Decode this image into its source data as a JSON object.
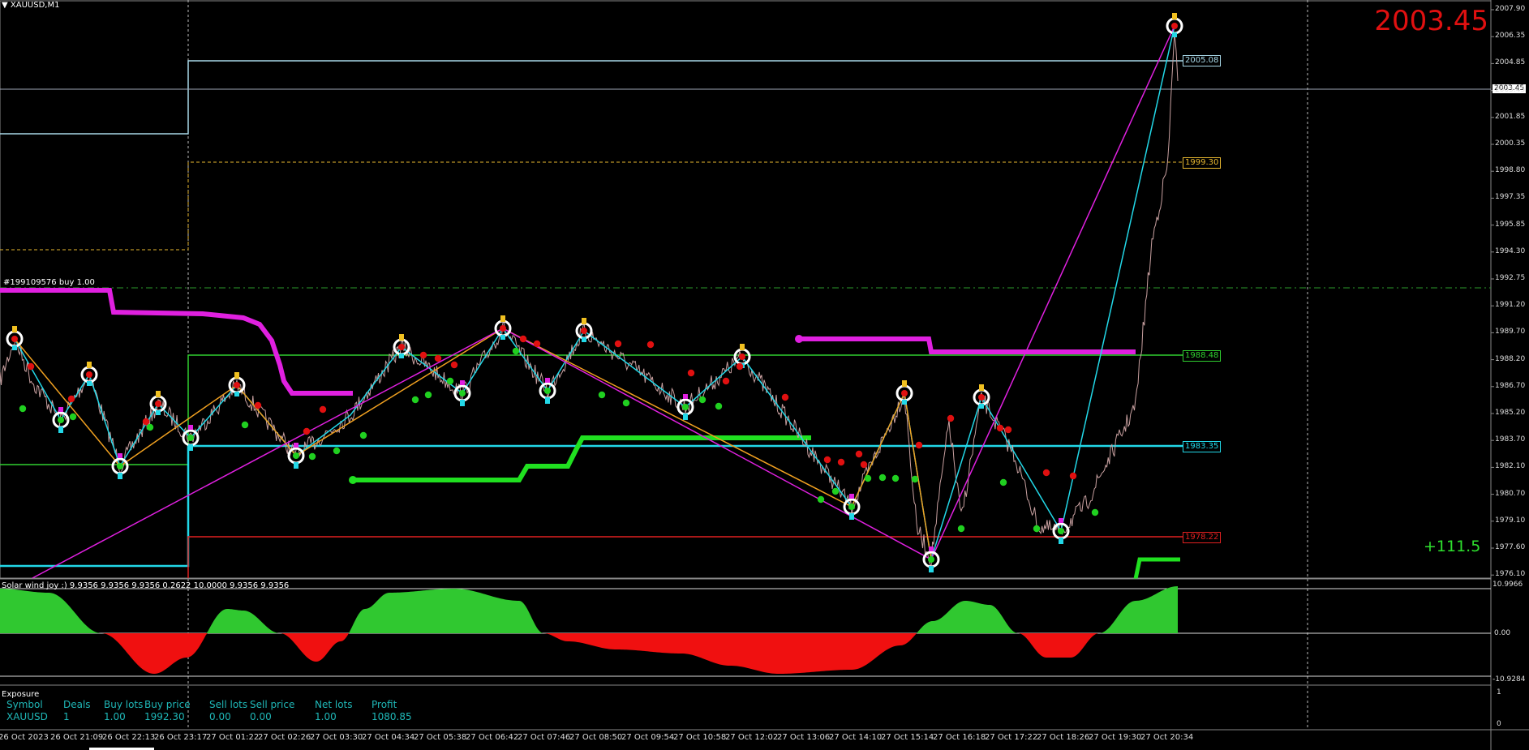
{
  "header": {
    "symbol_timeframe": "XAUUSD,M1"
  },
  "current_price_display": "2003.45",
  "current_price_tag": "2003.45",
  "order_label": "#199109576 buy 1.00",
  "profit_display": "+111.5",
  "price_axis": {
    "ticks": [
      "2007.90",
      "2006.35",
      "2004.85",
      "2003.45",
      "2001.85",
      "2000.35",
      "1998.80",
      "1997.35",
      "1995.85",
      "1994.30",
      "1992.75",
      "1991.20",
      "1989.70",
      "1988.20",
      "1986.70",
      "1985.20",
      "1983.70",
      "1982.10",
      "1980.70",
      "1979.10",
      "1977.60",
      "1976.10"
    ]
  },
  "level_boxes": [
    {
      "value": "2005.08",
      "color": "#a8d8e8"
    },
    {
      "value": "1999.30",
      "color": "#e8b830"
    },
    {
      "value": "1988.48",
      "color": "#30d030"
    },
    {
      "value": "1983.35",
      "color": "#22d8e8"
    },
    {
      "value": "1978.22",
      "color": "#e02020"
    }
  ],
  "indicator": {
    "label": "Solar wind joy :) 9.9356 9.9356 9.9356 0.2622 10.0000 9.9356 9.9356",
    "axis_top": "10.9966",
    "axis_mid": "0.00",
    "axis_bottom": "-10.9284"
  },
  "exposure": {
    "title": "Exposure",
    "headers": [
      "Symbol",
      "Deals",
      "Buy lots",
      "Buy price",
      "Sell lots",
      "Sell price",
      "Net lots",
      "Profit"
    ],
    "row": [
      "XAUUSD",
      "1",
      "1.00",
      "1992.30",
      "0.00",
      "0.00",
      "1.00",
      "1080.85"
    ],
    "axis_top": "1",
    "axis_bottom": "0"
  },
  "time_axis": [
    "26 Oct 2023",
    "26 Oct 21:09",
    "26 Oct 22:13",
    "26 Oct 23:17",
    "27 Oct 01:22",
    "27 Oct 02:26",
    "27 Oct 03:30",
    "27 Oct 04:34",
    "27 Oct 05:38",
    "27 Oct 06:42",
    "27 Oct 07:46",
    "27 Oct 08:50",
    "27 Oct 09:54",
    "27 Oct 10:58",
    "27 Oct 12:02",
    "27 Oct 13:06",
    "27 Oct 14:10",
    "27 Oct 15:14",
    "27 Oct 16:18",
    "27 Oct 17:22",
    "27 Oct 18:26",
    "27 Oct 19:30",
    "27 Oct 20:34"
  ],
  "colors": {
    "price_line": "#c8a0a0",
    "zigzag_cyan": "#22d8e8",
    "zigzag_orange": "#f0a020",
    "zigzag_magenta": "#e020e0",
    "osc_positive": "#30c830",
    "osc_negative": "#f01010",
    "up_dot": "#20d020",
    "down_dot": "#e01010"
  }
}
